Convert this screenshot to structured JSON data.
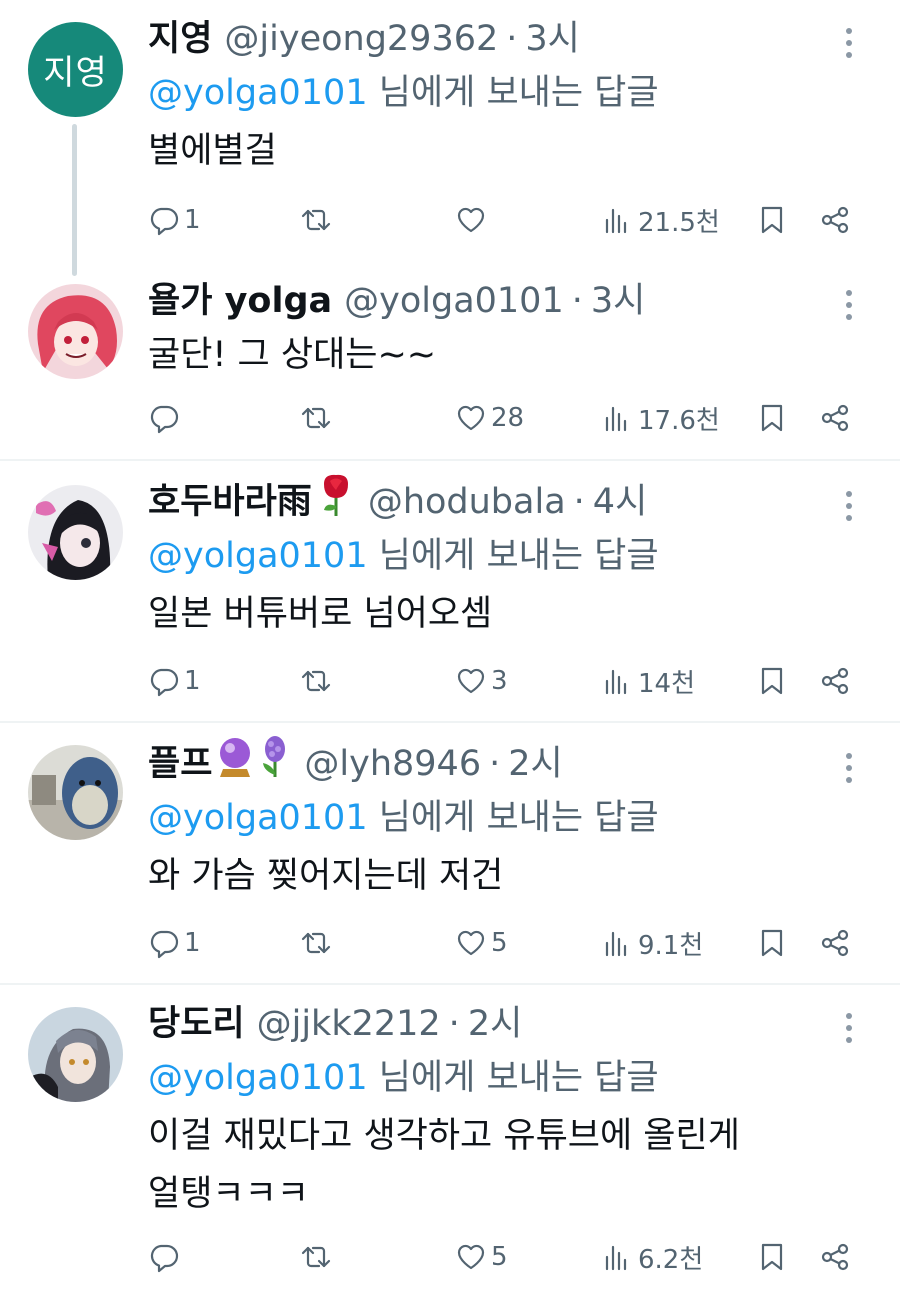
{
  "tweets": [
    {
      "name": "지영",
      "avatar_text": "지영",
      "handle": "@jiyeong29362",
      "time": "3시",
      "replying_to": "@yolga0101",
      "replying_suffix": " 님에게 보내는 답글",
      "text": "별에별걸",
      "replies": "1",
      "retweets": "",
      "likes": "",
      "views": "21.5천"
    },
    {
      "name": "욜가 yolga",
      "handle": "@yolga0101",
      "time": "3시",
      "text": "굴단! 그 상대는~~",
      "replies": "",
      "retweets": "",
      "likes": "28",
      "views": "17.6천"
    },
    {
      "name": "호두바라雨",
      "handle": "@hodubala",
      "time": "4시",
      "replying_to": "@yolga0101",
      "replying_suffix": " 님에게 보내는 답글",
      "text": "일본 버튜버로 넘어오셈",
      "replies": "1",
      "retweets": "",
      "likes": "3",
      "views": "14천"
    },
    {
      "name": "플프",
      "handle": "@lyh8946",
      "time": "2시",
      "replying_to": "@yolga0101",
      "replying_suffix": " 님에게 보내는 답글",
      "text": "와 가슴 찢어지는데 저건",
      "replies": "1",
      "retweets": "",
      "likes": "5",
      "views": "9.1천"
    },
    {
      "name": "당도리",
      "handle": "@jjkk2212",
      "time": "2시",
      "replying_to": "@yolga0101",
      "replying_suffix": " 님에게 보내는 답글",
      "text": "이걸 재밌다고 생각하고 유튜브에 올린게\n얼탱ㅋㅋㅋ",
      "replies": "",
      "retweets": "",
      "likes": "5",
      "views": "6.2천"
    }
  ],
  "separator": "·",
  "icons": {
    "reply": "reply-icon",
    "retweet": "retweet-icon",
    "like": "heart-icon",
    "views": "views-icon",
    "bookmark": "bookmark-icon",
    "share": "share-icon",
    "more": "more-icon"
  },
  "colors": {
    "mention": "#1d9bf0",
    "secondary_text": "#536471",
    "avatar_initials_bg": "#16897a",
    "thread_line": "#cfd9de",
    "divider": "#eff3f4"
  }
}
